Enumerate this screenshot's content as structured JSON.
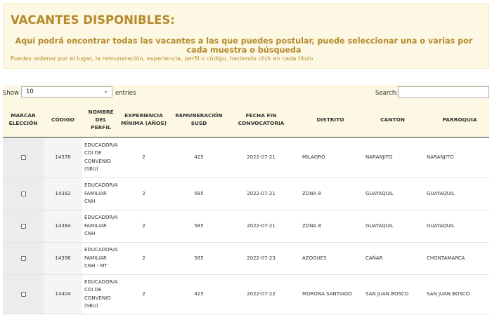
{
  "banner": {
    "title": "VACANTES DISPONIBLES:",
    "subtitle": "Aquí podrá encontrar todas las vacantes a las que puedes postular, puede seleccionar una o varias por cada muestra o búsqueda",
    "hint": "Puedes ordenar por el lugar, la remuneración, experiencia, perfil o código, haciendo click en cada titulo"
  },
  "controls": {
    "show_label": "Show",
    "page_size": "10",
    "entries_label": "entries",
    "search_label": "Search:",
    "search_value": ""
  },
  "table": {
    "headers": [
      "MARCAR ELECCIÓN",
      "CÓDIGO",
      "NOMBRE DEL PERFIL",
      "EXPERIENCIA MÍNIMA (AÑOS)",
      "REMUNERACIÓN $USD",
      "FECHA FIN CONVOCATORIA",
      "DISTRITO",
      "CANTÓN",
      "PARROQUIA"
    ],
    "rows": [
      {
        "codigo": "14378",
        "perfil": "EDUCADOR/A CDI DE CONVENIO (SBU)",
        "experiencia": "2",
        "remuneracion": "425",
        "fecha": "2022-07-21",
        "distrito": "MILAGRO",
        "canton": "NARANJITO",
        "parroquia": "NARANJITO",
        "checked": false
      },
      {
        "codigo": "14382",
        "perfil": "EDUCADOR/A FAMILIAR CNH",
        "experiencia": "2",
        "remuneracion": "585",
        "fecha": "2022-07-21",
        "distrito": "ZONA 8",
        "canton": "GUAYAQUIL",
        "parroquia": "GUAYAQUIL",
        "checked": false
      },
      {
        "codigo": "14384",
        "perfil": "EDUCADOR/A FAMILIAR CNH",
        "experiencia": "2",
        "remuneracion": "585",
        "fecha": "2022-07-21",
        "distrito": "ZONA 8",
        "canton": "GUAYAQUIL",
        "parroquia": "GUAYAQUIL",
        "checked": false
      },
      {
        "codigo": "14396",
        "perfil": "EDUCADOR/A FAMILIAR CNH - MT",
        "experiencia": "2",
        "remuneracion": "585",
        "fecha": "2022-07-23",
        "distrito": "AZOGUES",
        "canton": "CAÑAR",
        "parroquia": "CHONTAMARCA",
        "checked": false
      },
      {
        "codigo": "14404",
        "perfil": "EDUCADOR/A CDI DE CONVENIO (SBU)",
        "experiencia": "2",
        "remuneracion": "425",
        "fecha": "2022-07-22",
        "distrito": "MORONA SANTIAGO",
        "canton": "SAN JUAN BOSCO",
        "parroquia": "SAN JUAN BOSCO",
        "checked": false
      }
    ]
  },
  "colors": {
    "banner_bg": "#fcf8e3",
    "accent_text": "#b58a2c"
  }
}
